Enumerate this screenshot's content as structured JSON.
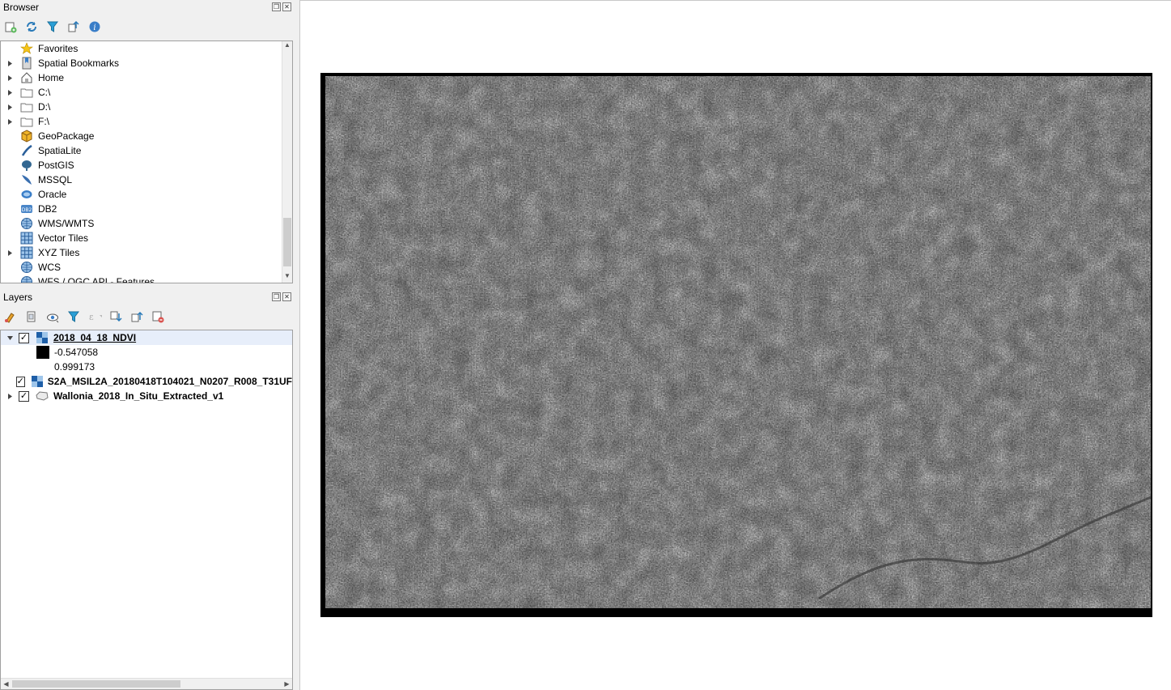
{
  "browser": {
    "title": "Browser",
    "toolbar": [
      "add-icon",
      "refresh-icon",
      "filter-icon",
      "collapse-icon",
      "info-icon"
    ],
    "items": [
      {
        "label": "Favorites",
        "icon": "star-icon",
        "expandable": false
      },
      {
        "label": "Spatial Bookmarks",
        "icon": "bookmark-icon",
        "expandable": true
      },
      {
        "label": "Home",
        "icon": "home-icon",
        "expandable": true
      },
      {
        "label": "C:\\",
        "icon": "folder-icon",
        "expandable": true
      },
      {
        "label": "D:\\",
        "icon": "folder-icon",
        "expandable": true
      },
      {
        "label": "F:\\",
        "icon": "folder-icon",
        "expandable": true
      },
      {
        "label": "GeoPackage",
        "icon": "geopackage-icon",
        "expandable": false
      },
      {
        "label": "SpatiaLite",
        "icon": "spatialite-icon",
        "expandable": false
      },
      {
        "label": "PostGIS",
        "icon": "postgis-icon",
        "expandable": false
      },
      {
        "label": "MSSQL",
        "icon": "mssql-icon",
        "expandable": false
      },
      {
        "label": "Oracle",
        "icon": "oracle-icon",
        "expandable": false
      },
      {
        "label": "DB2",
        "icon": "db2-icon",
        "expandable": false
      },
      {
        "label": "WMS/WMTS",
        "icon": "globe-icon",
        "expandable": false
      },
      {
        "label": "Vector Tiles",
        "icon": "grid-icon",
        "expandable": false
      },
      {
        "label": "XYZ Tiles",
        "icon": "grid-icon",
        "expandable": true
      },
      {
        "label": "WCS",
        "icon": "globe-icon",
        "expandable": false
      },
      {
        "label": "WFS / OGC API - Features",
        "icon": "globe-icon",
        "expandable": false
      }
    ]
  },
  "layers": {
    "title": "Layers",
    "toolbar": [
      "style-icon",
      "add-group-icon",
      "eye-icon",
      "filter-icon",
      "expression-icon",
      "expand-all-icon",
      "collapse-all-icon",
      "remove-layer-icon"
    ],
    "items": [
      {
        "name": "2018_04_18_NDVI",
        "checked": true,
        "expanded": true,
        "bold": true,
        "type": "raster"
      },
      {
        "name": "S2A_MSIL2A_20180418T104021_N0207_R008_T31UF",
        "checked": true,
        "expanded": false,
        "bold": true,
        "type": "raster"
      },
      {
        "name": "Wallonia_2018_In_Situ_Extracted_v1",
        "checked": true,
        "expanded": false,
        "bold": true,
        "type": "vector"
      }
    ],
    "legend": {
      "min": "-0.547058",
      "max": "0.999173"
    }
  },
  "colors": {
    "selection": "#e7eefa",
    "panel": "#f0f0f0",
    "canvas": "#ffffff"
  }
}
